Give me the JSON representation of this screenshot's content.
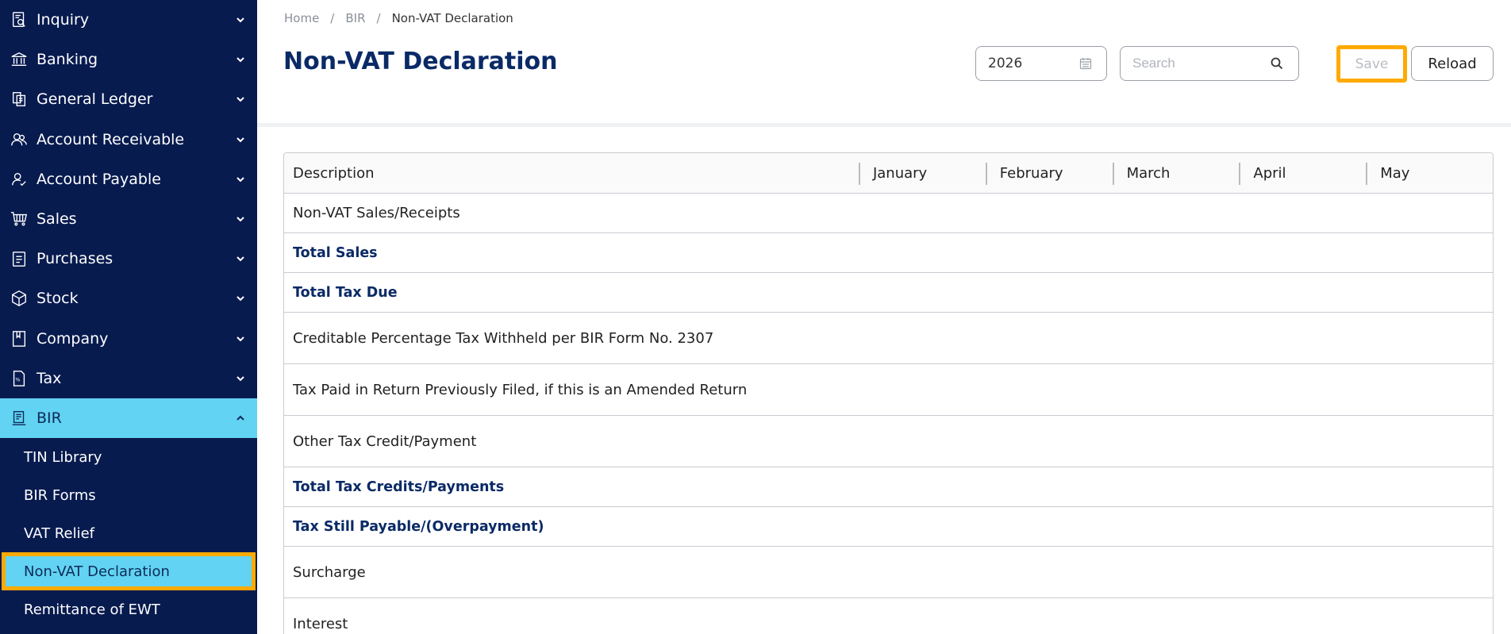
{
  "sidebar": {
    "items": [
      {
        "label": "Inquiry",
        "icon": "inquiry-icon"
      },
      {
        "label": "Banking",
        "icon": "bank-icon"
      },
      {
        "label": "General Ledger",
        "icon": "ledger-icon"
      },
      {
        "label": "Account Receivable",
        "icon": "receivable-icon"
      },
      {
        "label": "Account Payable",
        "icon": "payable-icon"
      },
      {
        "label": "Sales",
        "icon": "cart-icon"
      },
      {
        "label": "Purchases",
        "icon": "clipboard-icon"
      },
      {
        "label": "Stock",
        "icon": "box-icon"
      },
      {
        "label": "Company",
        "icon": "book-icon"
      },
      {
        "label": "Tax",
        "icon": "tax-icon"
      },
      {
        "label": "BIR",
        "icon": "bir-icon"
      }
    ],
    "bir_sub": [
      {
        "label": "TIN Library"
      },
      {
        "label": "BIR Forms"
      },
      {
        "label": "VAT Relief"
      },
      {
        "label": "Non-VAT Declaration"
      },
      {
        "label": "Remittance of EWT"
      }
    ]
  },
  "breadcrumb": {
    "home": "Home",
    "sep1": "/",
    "bir": "BIR",
    "sep2": "/",
    "current": "Non-VAT Declaration"
  },
  "page": {
    "title": "Non-VAT Declaration"
  },
  "toolbar": {
    "year_value": "2026",
    "search_placeholder": "Search",
    "save_label": "Save",
    "reload_label": "Reload"
  },
  "table": {
    "headers": [
      "Description",
      "January",
      "February",
      "March",
      "April",
      "May"
    ],
    "rows": [
      {
        "label": "Non-VAT Sales/Receipts"
      },
      {
        "label": "Total Sales"
      },
      {
        "label": "Total Tax Due"
      },
      {
        "label": "Creditable Percentage Tax Withheld per BIR Form No. 2307"
      },
      {
        "label": "Tax Paid in Return Previously Filed, if this is an Amended Return"
      },
      {
        "label": "Other Tax Credit/Payment"
      },
      {
        "label": "Total Tax Credits/Payments"
      },
      {
        "label": "Tax Still Payable/(Overpayment)"
      },
      {
        "label": "Surcharge"
      },
      {
        "label": "Interest"
      }
    ]
  },
  "colors": {
    "sidebar_bg": "#081b4f",
    "active_bg": "#62d3f2",
    "highlight": "#ffaa00",
    "title_color": "#0a2a66"
  }
}
